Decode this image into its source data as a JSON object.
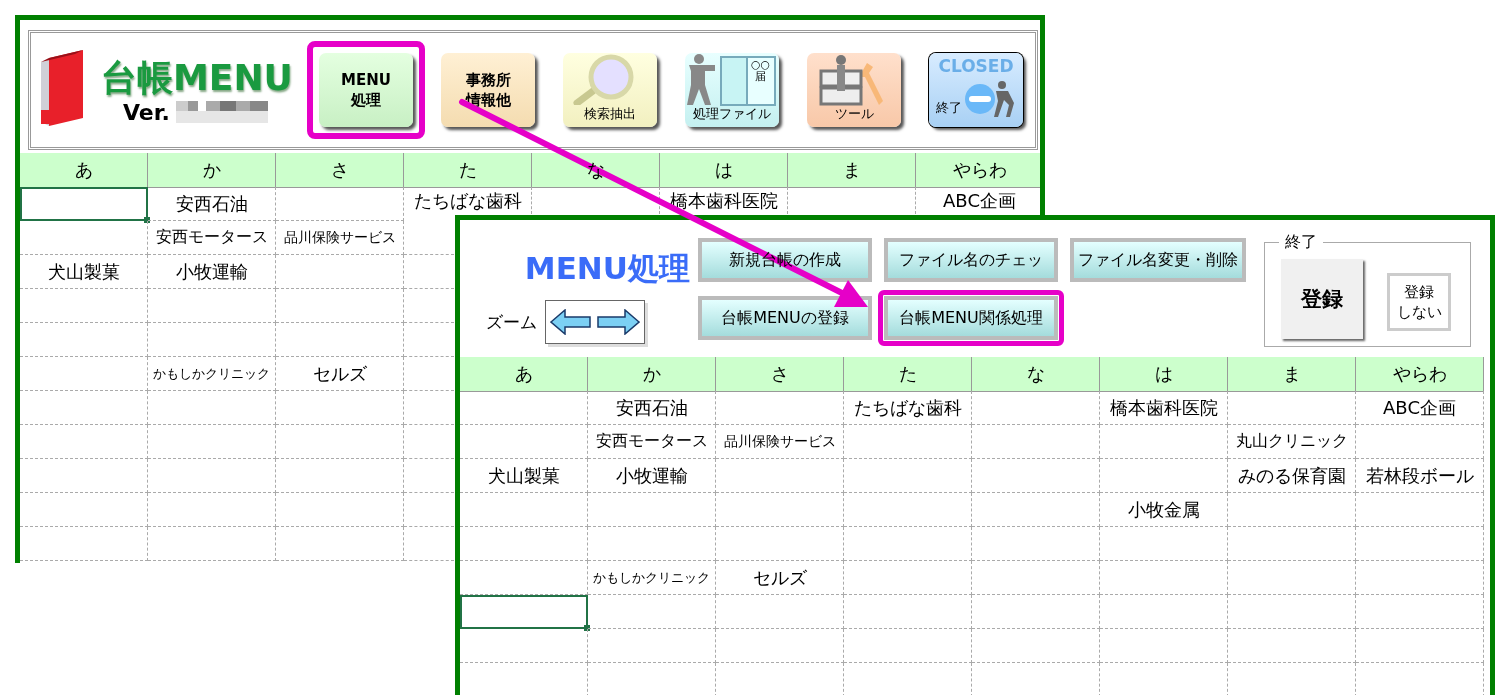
{
  "back_window": {
    "logo": {
      "title": "台帳MENU",
      "version_label": "Ver."
    },
    "toolbar": [
      {
        "kind": "menu",
        "label_lines": [
          "MENU",
          "処理"
        ],
        "highlighted": true
      },
      {
        "kind": "office",
        "label_lines": [
          "事務所",
          "情報他"
        ],
        "highlighted": false
      },
      {
        "kind": "search",
        "label": "検索抽出",
        "highlighted": false
      },
      {
        "kind": "file",
        "label": "処理ファイル",
        "note_lines": [
          "○○",
          "届"
        ],
        "highlighted": false
      },
      {
        "kind": "tool",
        "label": "ツール",
        "highlighted": false
      },
      {
        "kind": "closed",
        "sign": "CLOSED",
        "label": "終了",
        "highlighted": false
      }
    ],
    "table": {
      "columns": [
        "あ",
        "か",
        "さ",
        "た",
        "な",
        "は",
        "ま",
        "やらわ"
      ],
      "rows": [
        {
          "cells": [
            {
              "selected": true
            },
            {
              "text": "安西石油",
              "selected": false
            },
            {
              "selected": false
            },
            {
              "text": "たちばな歯科",
              "selected": false
            },
            {
              "selected": false
            },
            {
              "text": "橋本歯科医院",
              "selected": false
            },
            {
              "selected": false
            },
            {
              "text": "ABC企画",
              "selected": false
            }
          ]
        },
        {
          "cells": [
            {
              "selected": false
            },
            {
              "text": "安西モータース",
              "selected": false
            },
            {
              "text": "品川保険サービス",
              "selected": false
            },
            {
              "selected": false
            }
          ]
        },
        {
          "cells": [
            {
              "text": "犬山製菓",
              "selected": false
            },
            {
              "text": "小牧運輸",
              "selected": false
            },
            {
              "selected": false
            },
            {
              "selected": false
            }
          ]
        },
        {
          "cells": [
            {
              "selected": false
            },
            {
              "selected": false
            },
            {
              "selected": false
            },
            {
              "selected": false
            }
          ]
        },
        {
          "cells": [
            {
              "selected": false
            },
            {
              "selected": false
            },
            {
              "selected": false
            },
            {
              "selected": false
            }
          ]
        },
        {
          "cells": [
            {
              "selected": false
            },
            {
              "text": "かもしかクリニック",
              "selected": false
            },
            {
              "text": "セルズ",
              "selected": false
            },
            {
              "selected": false
            }
          ]
        },
        {
          "cells": [
            {
              "selected": false
            },
            {
              "selected": false
            },
            {
              "selected": false
            },
            {
              "selected": false
            }
          ]
        },
        {
          "cells": [
            {
              "selected": false
            },
            {
              "selected": false
            },
            {
              "selected": false
            },
            {
              "selected": false
            }
          ]
        },
        {
          "cells": [
            {
              "selected": false
            },
            {
              "selected": false
            },
            {
              "selected": false
            },
            {
              "selected": false
            }
          ]
        },
        {
          "cells": [
            {
              "selected": false
            },
            {
              "selected": false
            },
            {
              "selected": false
            },
            {
              "selected": false
            }
          ]
        },
        {
          "cells": [
            {
              "selected": false
            },
            {
              "selected": false
            },
            {
              "selected": false
            },
            {
              "selected": false
            }
          ]
        }
      ]
    }
  },
  "front_window": {
    "title": "MENU処理",
    "zoom_label": "ズーム",
    "buttons": [
      {
        "label": "新規台帳の作成",
        "highlighted": false
      },
      {
        "label": "ファイル名のチェッ",
        "highlighted": false
      },
      {
        "label": "ファイル名変更・削除",
        "highlighted": false
      },
      {
        "label": "台帳MENUの登録",
        "highlighted": false
      },
      {
        "label": "台帳MENU関係処理",
        "highlighted": true
      }
    ],
    "exit_group": {
      "legend": "終了",
      "register": "登録",
      "no_register_lines": [
        "登録",
        "しない"
      ]
    },
    "table": {
      "columns": [
        "あ",
        "か",
        "さ",
        "た",
        "な",
        "は",
        "ま",
        "やらわ"
      ],
      "rows": [
        {
          "cells": [
            {
              "selected": false
            },
            {
              "text": "安西石油",
              "selected": false
            },
            {
              "selected": false
            },
            {
              "text": "たちばな歯科",
              "selected": false
            },
            {
              "selected": false
            },
            {
              "text": "橋本歯科医院",
              "selected": false
            },
            {
              "selected": false
            },
            {
              "text": "ABC企画",
              "selected": false
            }
          ]
        },
        {
          "cells": [
            {
              "selected": false
            },
            {
              "text": "安西モータース",
              "selected": false
            },
            {
              "text": "品川保険サービス",
              "selected": false
            },
            {
              "selected": false
            },
            {
              "selected": false
            },
            {
              "selected": false
            },
            {
              "text": "丸山クリニック",
              "selected": false
            },
            {
              "selected": false
            }
          ]
        },
        {
          "cells": [
            {
              "text": "犬山製菓",
              "selected": false
            },
            {
              "text": "小牧運輸",
              "selected": false
            },
            {
              "selected": false
            },
            {
              "selected": false
            },
            {
              "selected": false
            },
            {
              "selected": false
            },
            {
              "text": "みのる保育園",
              "selected": false
            },
            {
              "text": "若林段ボール",
              "selected": false
            }
          ]
        },
        {
          "cells": [
            {
              "selected": false
            },
            {
              "selected": false
            },
            {
              "selected": false
            },
            {
              "selected": false
            },
            {
              "selected": false
            },
            {
              "text": "小牧金属",
              "selected": false
            },
            {
              "selected": false
            },
            {
              "selected": false
            }
          ]
        },
        {
          "cells": [
            {
              "selected": false
            },
            {
              "selected": false
            },
            {
              "selected": false
            },
            {
              "selected": false
            },
            {
              "selected": false
            },
            {
              "selected": false
            },
            {
              "selected": false
            },
            {
              "selected": false
            }
          ]
        },
        {
          "cells": [
            {
              "selected": false
            },
            {
              "text": "かもしかクリニック",
              "selected": false
            },
            {
              "text": "セルズ",
              "selected": false
            },
            {
              "selected": false
            },
            {
              "selected": false
            },
            {
              "selected": false
            },
            {
              "selected": false
            },
            {
              "selected": false
            }
          ]
        },
        {
          "cells": [
            {
              "selected": true
            },
            {
              "selected": false
            },
            {
              "selected": false
            },
            {
              "selected": false
            },
            {
              "selected": false
            },
            {
              "selected": false
            },
            {
              "selected": false
            },
            {
              "selected": false
            }
          ]
        },
        {
          "cells": [
            {
              "selected": false
            },
            {
              "selected": false
            },
            {
              "selected": false
            },
            {
              "selected": false
            },
            {
              "selected": false
            },
            {
              "selected": false
            },
            {
              "selected": false
            },
            {
              "selected": false
            }
          ]
        },
        {
          "cells": [
            {
              "selected": false
            },
            {
              "selected": false
            },
            {
              "selected": false
            },
            {
              "selected": false
            },
            {
              "selected": false
            },
            {
              "selected": false
            },
            {
              "selected": false
            },
            {
              "selected": false
            }
          ]
        }
      ]
    }
  }
}
